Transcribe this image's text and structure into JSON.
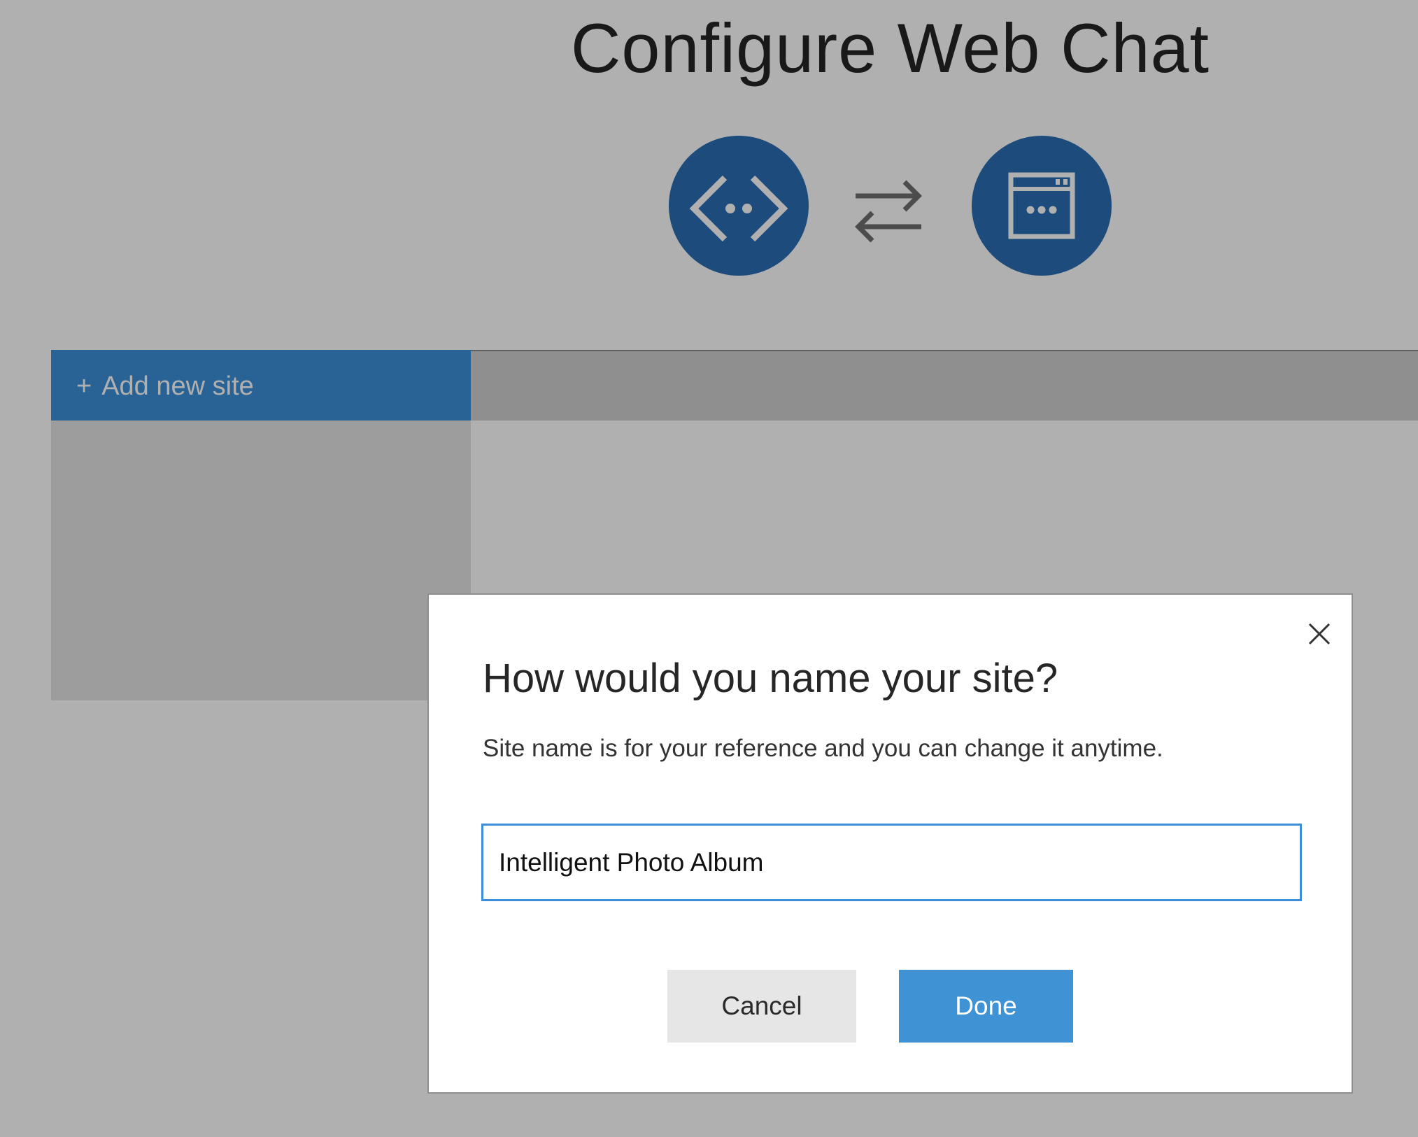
{
  "page": {
    "title": "Configure Web Chat"
  },
  "icons": {
    "left": "code-brackets-icon",
    "middle": "swap-arrows-icon",
    "right": "browser-window-icon"
  },
  "tabs": {
    "add_new_site_label": "Add new site",
    "add_new_site_plus": "+"
  },
  "dialog": {
    "title": "How would you name your site?",
    "subtitle": "Site name is for your reference and you can change it anytime.",
    "site_name_value": "Intelligent Photo Album",
    "cancel_label": "Cancel",
    "done_label": "Done",
    "close_icon": "close-icon"
  },
  "colors": {
    "accent": "#3c8ed8",
    "done_button": "#3f93d5",
    "cancel_button": "#e6e6e6",
    "overlay": "rgba(0,0,0,0.31)"
  }
}
